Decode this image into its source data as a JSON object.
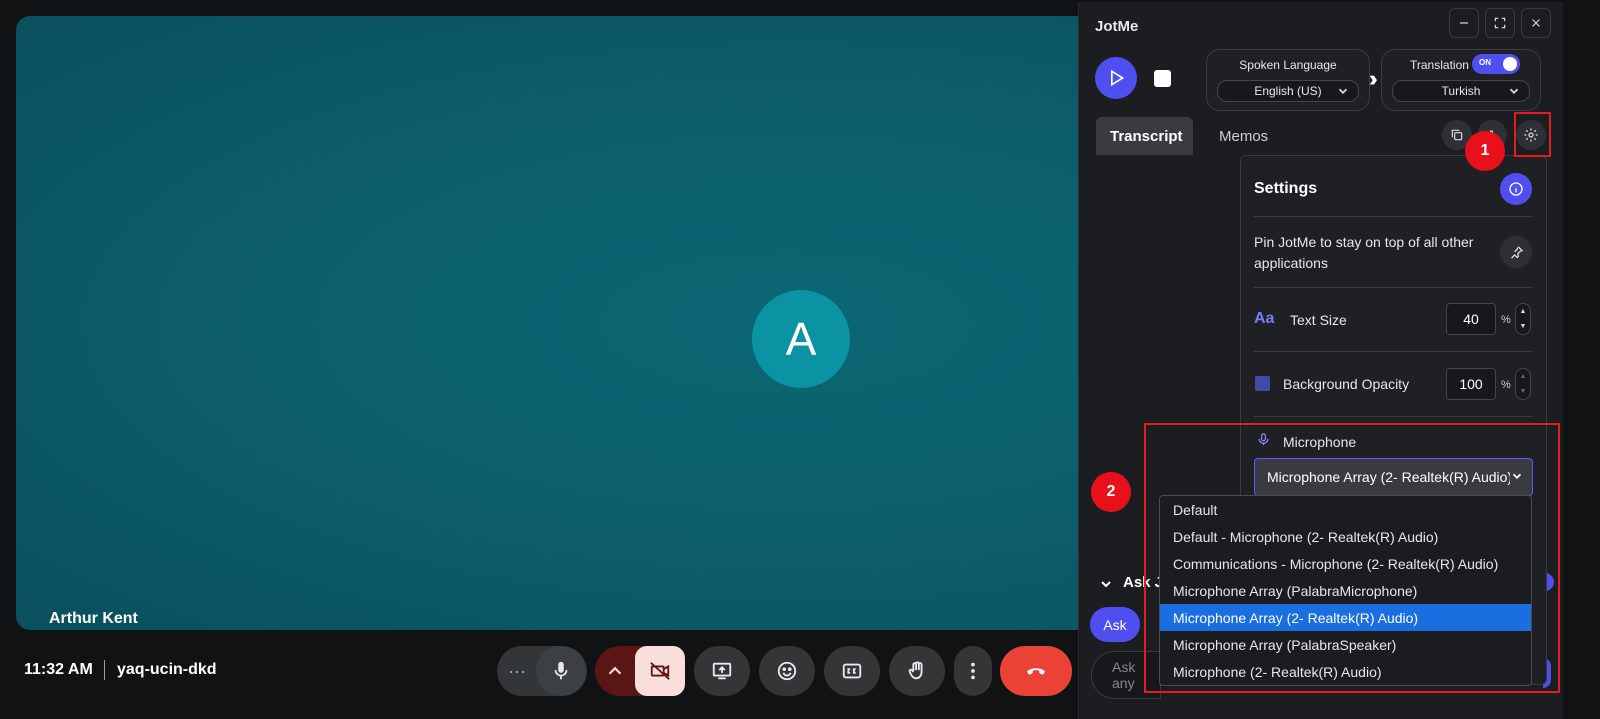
{
  "meet": {
    "participant_initial": "A",
    "participant_name": "Arthur Kent",
    "time": "11:32 AM",
    "meeting_code": "yaq-ucin-dkd",
    "more_options_glyph": "···",
    "colors": {
      "tile": "#0d5f6c",
      "avatar": "#0b93a4",
      "leave": "#ea4335",
      "camera_off": "#f9dedc"
    }
  },
  "jotme": {
    "title": "JotMe",
    "spoken_language": {
      "label": "Spoken Language",
      "value": "English (US)"
    },
    "translation": {
      "label": "Translation",
      "toggle_text": "ON",
      "value": "Turkish"
    },
    "tabs": [
      {
        "label": "Transcript",
        "active": true
      },
      {
        "label": "Memos",
        "active": false
      }
    ],
    "settings": {
      "title": "Settings",
      "pin_text": "Pin JotMe to stay on top of all other applications",
      "text_size": {
        "icon_text": "Aa",
        "label": "Text Size",
        "value": "40",
        "unit": "%"
      },
      "background_opacity": {
        "label": "Background Opacity",
        "value": "100",
        "unit": "%"
      },
      "microphone": {
        "label": "Microphone",
        "selected": "Microphone Array (2- Realtek(R) Audio)",
        "options": [
          "Default",
          "Default - Microphone (2- Realtek(R) Audio)",
          "Communications - Microphone (2- Realtek(R) Audio)",
          "Microphone Array (PalabraMicrophone)",
          "Microphone Array (2- Realtek(R) Audio)",
          "Microphone Array (PalabraSpeaker)",
          "Microphone (2- Realtek(R) Audio)"
        ],
        "selected_index": 4
      }
    },
    "ask": {
      "header": "Ask J",
      "button": "Ask",
      "placeholder": "Ask any"
    },
    "colors": {
      "accent": "#4f4ff0",
      "panel": "#1c1d20",
      "selected_option": "#1a6fe0"
    }
  },
  "annotations": {
    "marker_1": "1",
    "marker_2": "2",
    "color": "#e01c24"
  }
}
